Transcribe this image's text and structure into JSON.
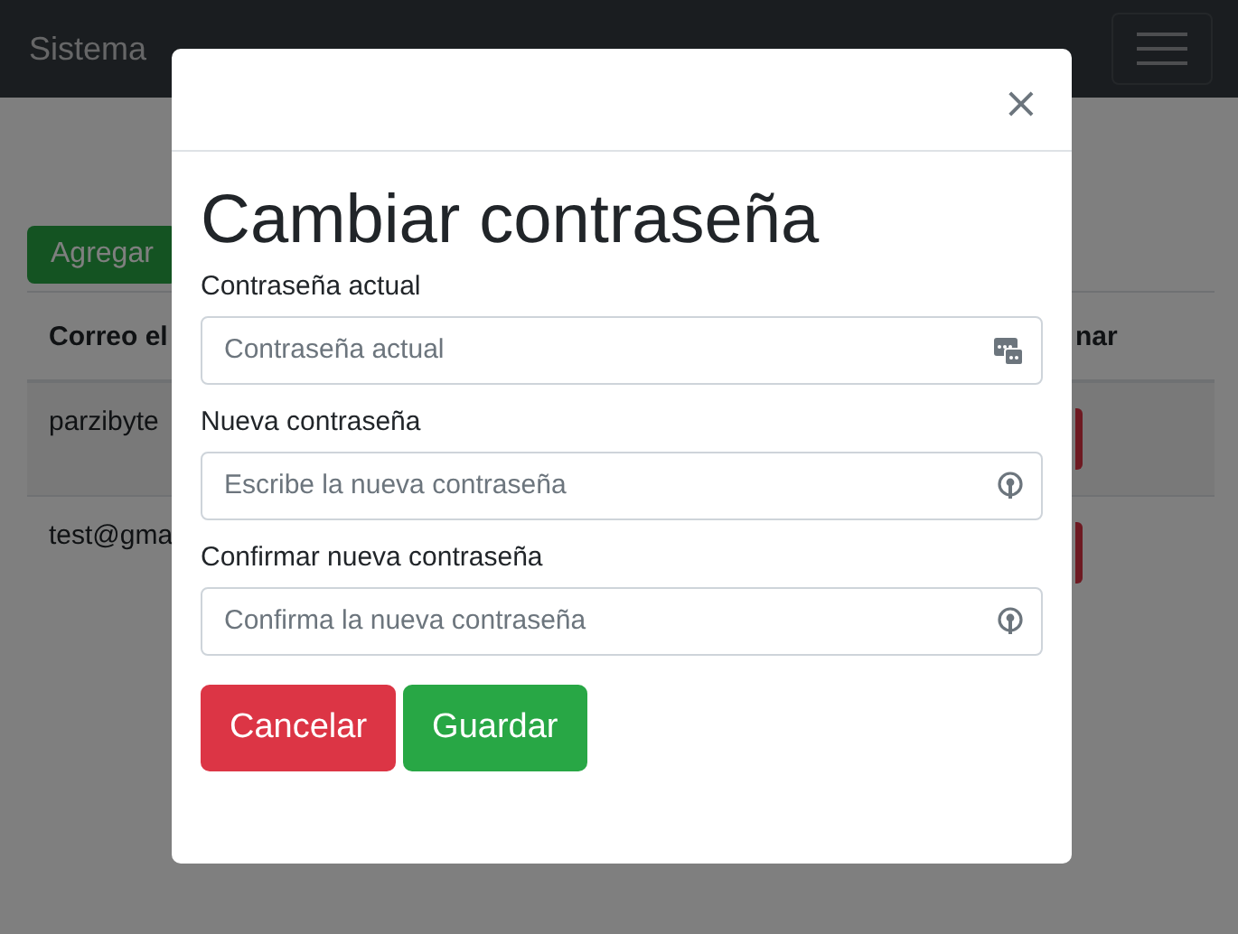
{
  "navbar": {
    "brand": "Sistema"
  },
  "page": {
    "add_button": "Agregar",
    "table": {
      "columns": [
        "Correo el",
        "nar"
      ],
      "rows": [
        {
          "email": "parzibyte"
        },
        {
          "email": "test@gma"
        }
      ]
    }
  },
  "modal": {
    "close": "×",
    "title": "Cambiar contraseña",
    "fields": [
      {
        "kind": "current",
        "label": "Contraseña actual",
        "placeholder": "Contraseña actual"
      },
      {
        "kind": "new",
        "label": "Nueva contraseña",
        "placeholder": "Escribe la nueva contraseña"
      },
      {
        "kind": "new",
        "label": "Confirmar nueva contraseña",
        "placeholder": "Confirma la nueva contraseña"
      }
    ],
    "buttons": [
      {
        "kind": "danger",
        "label": "Cancelar"
      },
      {
        "kind": "success",
        "label": "Guardar"
      }
    ]
  }
}
